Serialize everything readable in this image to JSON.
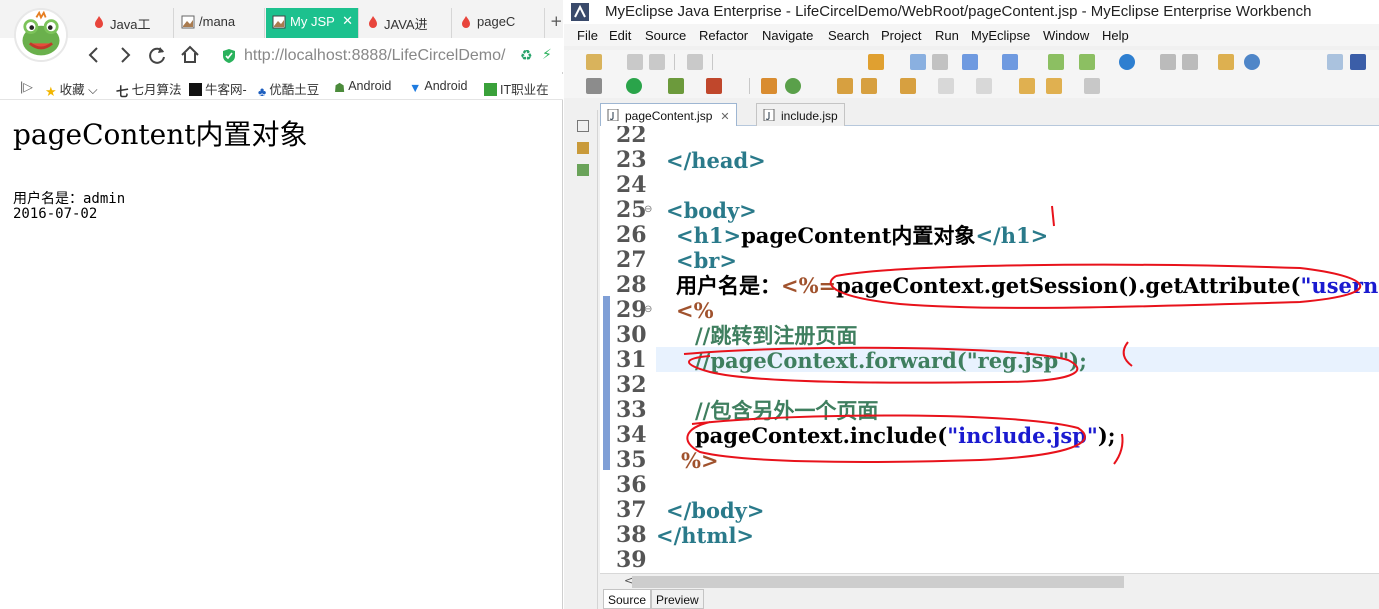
{
  "browser": {
    "tabs": [
      {
        "label": "Java工"
      },
      {
        "label": "/mana"
      },
      {
        "label": "My JSP"
      },
      {
        "label": "JAVA进"
      },
      {
        "label": "pageC"
      }
    ],
    "new_tab": "+",
    "address": {
      "host": "http://localhost",
      "rest": ":8888/LifeCircelDemo/"
    },
    "bookmarks": [
      "收藏",
      "七月算法",
      "牛客网-",
      "优酷土豆",
      "Android",
      "Android",
      "IT职业在"
    ],
    "page": {
      "h1": "pageContent内置对象",
      "user_line": "用户名是：admin",
      "date_line": "2016-07-02"
    }
  },
  "ide": {
    "title": "MyEclipse Java Enterprise - LifeCircelDemo/WebRoot/pageContent.jsp - MyEclipse Enterprise Workbench",
    "menu": [
      "File",
      "Edit",
      "Source",
      "Refactor",
      "Navigate",
      "Search",
      "Project",
      "Run",
      "MyEclipse",
      "Window",
      "Help"
    ],
    "editor_tabs": [
      {
        "label": "pageContent.jsp",
        "close": "✕"
      },
      {
        "label": "include.jsp"
      }
    ],
    "bottom_tabs": [
      "Source",
      "Preview"
    ],
    "line_numbers": [
      "22",
      "23",
      "24",
      "25",
      "26",
      "27",
      "28",
      "29",
      "30",
      "31",
      "32",
      "33",
      "34",
      "35",
      "36",
      "37",
      "38",
      "39"
    ],
    "code": {
      "l23": "</head>",
      "l25": "<body>",
      "l26_open": "<h1>",
      "l26_text": "pageContent内置对象",
      "l26_close": "</h1>",
      "l27": "<br>",
      "l28_label": "用户名是：",
      "l28_open": "<%=",
      "l28_expr": "pageContext.getSession().getAttribute(",
      "l28_str": "\"usernam",
      "l29": "<%",
      "l30": "//跳转到注册页面",
      "l31": "//pageContext.forward(\"reg.jsp\");",
      "l33": "//包含另外一个页面",
      "l34_call": "pageContext.include(",
      "l34_str": "\"include.jsp\"",
      "l34_end": ");",
      "l35": "%>",
      "l37": "</body>",
      "l38": "</html>"
    }
  }
}
